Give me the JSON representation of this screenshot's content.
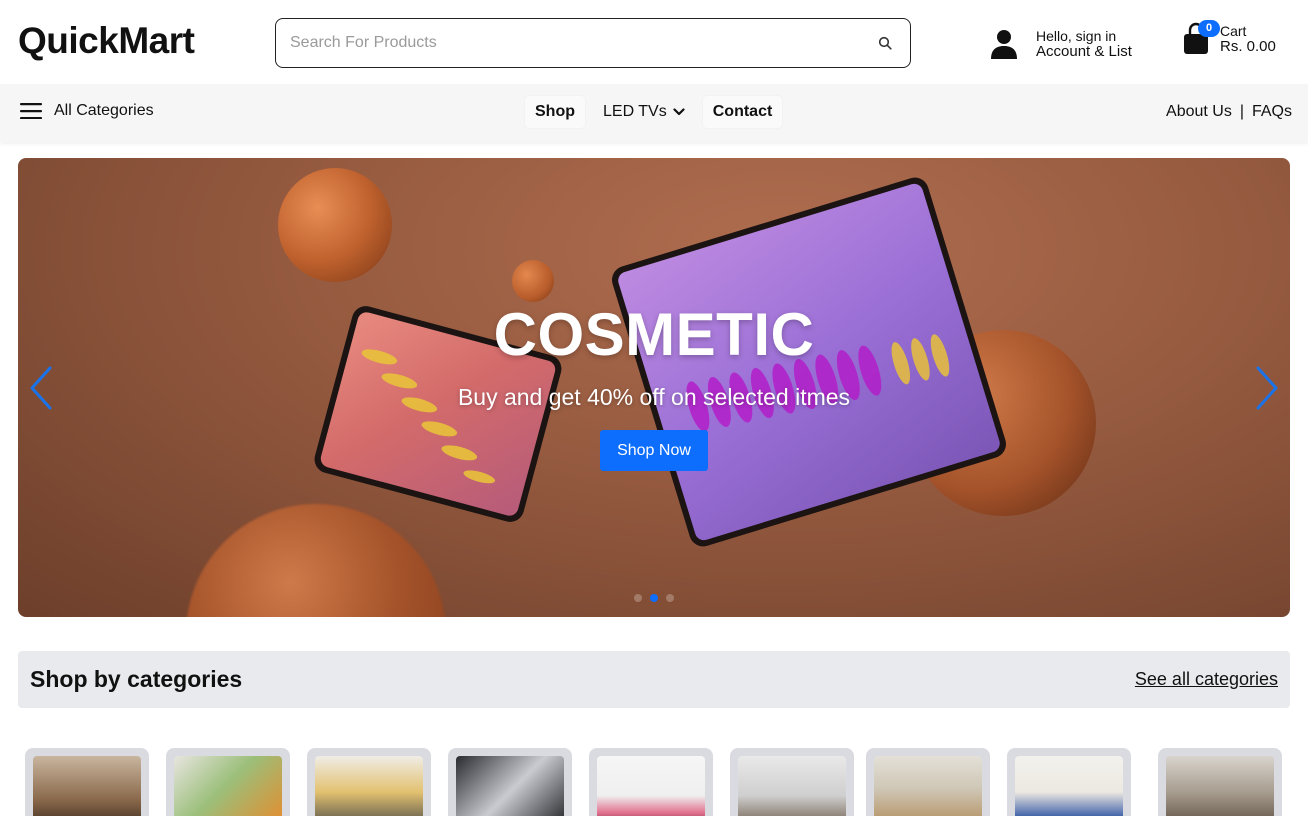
{
  "header": {
    "logo": "QuickMart",
    "search": {
      "placeholder": "Search For Products",
      "icon": "search-icon"
    },
    "account": {
      "greeting": "Hello, sign in",
      "label": "Account & List",
      "icon": "user-icon"
    },
    "cart": {
      "label": "Cart",
      "total": "Rs. 0.00",
      "count": "0",
      "icon": "shopping-bag-icon"
    }
  },
  "nav": {
    "all_categories": "All Categories",
    "links": [
      {
        "label": "Shop"
      },
      {
        "label": "LED TVs",
        "icon": "chevron-down-icon"
      },
      {
        "label": "Contact"
      }
    ],
    "right": {
      "about": "About Us",
      "separator": "|",
      "faqs": "FAQs"
    }
  },
  "hero": {
    "title": "COSMETIC",
    "subtitle": "Buy and get 40% off on selected itmes",
    "button": "Shop Now",
    "slides_total": 3,
    "active_slide": 2
  },
  "categories": {
    "title": "Shop by categories",
    "see_all": "See all categories",
    "tile_count": 9
  },
  "colors": {
    "accent": "#0d6efd",
    "nav_bg": "#f6f6f6",
    "category_bar_bg": "#e9eaed",
    "hero_bg": "#955a3f"
  }
}
